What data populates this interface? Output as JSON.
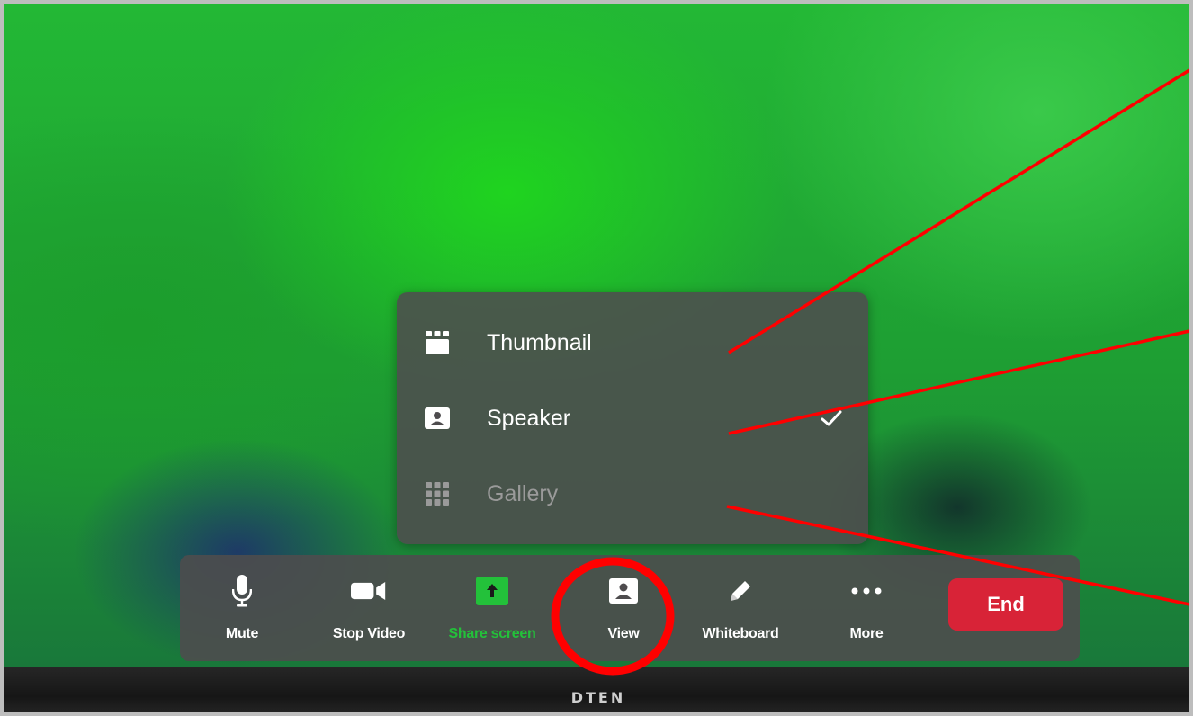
{
  "device": {
    "brand": "DTEN"
  },
  "view_menu": {
    "items": [
      {
        "label": "Thumbnail",
        "icon": "thumbnail-icon",
        "selected": false,
        "enabled": true
      },
      {
        "label": "Speaker",
        "icon": "speaker-view-icon",
        "selected": true,
        "enabled": true
      },
      {
        "label": "Gallery",
        "icon": "gallery-grid-icon",
        "selected": false,
        "enabled": false
      }
    ]
  },
  "toolbar": {
    "mute_label": "Mute",
    "stop_video_label": "Stop Video",
    "share_screen_label": "Share screen",
    "view_label": "View",
    "whiteboard_label": "Whiteboard",
    "more_label": "More",
    "end_label": "End"
  },
  "colors": {
    "end_red": "#d82337",
    "share_green": "#23c13a",
    "annotation_red": "#ff0000",
    "menu_bg": "#4e4c4e"
  }
}
